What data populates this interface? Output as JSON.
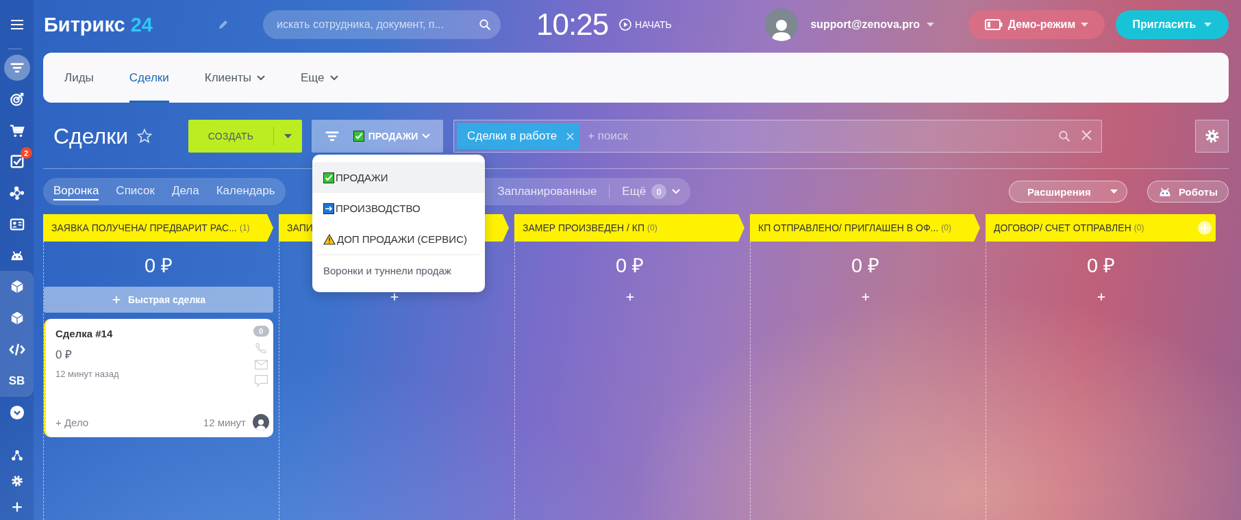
{
  "sidebar": {
    "menu": [
      {
        "selected": true
      },
      {
        "selected": false
      },
      {
        "selected": false
      },
      {
        "selected": false,
        "badge": "2"
      },
      {
        "selected": false
      },
      {
        "selected": false
      },
      {
        "selected": false
      }
    ],
    "pinned": [
      {
        "selected": false
      },
      {
        "selected": false
      },
      {
        "selected": false
      },
      {
        "selected": false,
        "label": "SB"
      }
    ],
    "tools": [
      {
        "selected": false
      },
      {
        "selected": false
      },
      {
        "selected": false
      }
    ]
  },
  "header": {
    "logo": "Битрикс",
    "logo_accent": "24",
    "search": {
      "placeholder": "искать сотрудника, документ, п..."
    },
    "time": "10:25",
    "start": "НАЧАТЬ",
    "user": "support@zenova.pro",
    "demo": "Демо-режим",
    "invite": "Пригласить"
  },
  "nav": {
    "tabs": [
      {
        "label": "Лиды",
        "selected": false,
        "menu": false
      },
      {
        "label": "Сделки",
        "selected": true,
        "menu": false
      },
      {
        "label": "Клиенты",
        "selected": false,
        "menu": true
      },
      {
        "label": "Еще",
        "selected": false,
        "menu": true
      }
    ]
  },
  "toolbar": {
    "title": "Сделки",
    "create": "СОЗДАТЬ",
    "category": "ПРОДАЖИ",
    "filter_tag": "Сделки в работе",
    "search_placeholder": "+ поиск"
  },
  "category_menu": {
    "items": [
      {
        "label": "ПРОДАЖИ",
        "kind": "check",
        "selected": true
      },
      {
        "label": "ПРОИЗВОДСТВО",
        "kind": "arrow",
        "selected": false
      },
      {
        "label": "ДОП ПРОДАЖИ (СЕРВИС)",
        "kind": "warning",
        "selected": false
      }
    ],
    "footer": "Воронки и туннели продаж"
  },
  "views": {
    "tabs": [
      {
        "label": "Воронка",
        "selected": true
      },
      {
        "label": "Список",
        "selected": false
      },
      {
        "label": "Дела",
        "selected": false
      },
      {
        "label": "Календарь",
        "selected": false
      }
    ],
    "counters": [
      {
        "label": "Запланированные"
      },
      {
        "label": "Ещё",
        "count": "0"
      }
    ],
    "extensions": "Расширения",
    "robots": "Роботы"
  },
  "board": {
    "columns": [
      {
        "title": "ЗАЯВКА ПОЛУЧЕНА/ ПРЕДВАРИТ РАС...",
        "count": "(1)",
        "sum": "0 ₽",
        "quick_add": "Быстрая сделка",
        "cards": [
          {
            "title": "Сделка #14",
            "sum": "0 ₽",
            "created": "12 минут назад",
            "activities": "0",
            "add_activity": "+ Дело",
            "last_activity": "12 минут"
          }
        ]
      },
      {
        "title": "ЗАПИ"
      },
      {
        "title": "ЗАМЕР ПРОИЗВЕДЕН / КП",
        "count": "(0)",
        "sum": "0 ₽"
      },
      {
        "title": "КП ОТПРАВЛЕНО/ ПРИГЛАШЕН В ОФ...",
        "count": "(0)",
        "sum": "0 ₽"
      },
      {
        "title": "ДОГОВОР/ СЧЕТ ОТПРАВЛЕН",
        "count": "(0)",
        "sum": "0 ₽",
        "add_stage": true
      }
    ]
  }
}
